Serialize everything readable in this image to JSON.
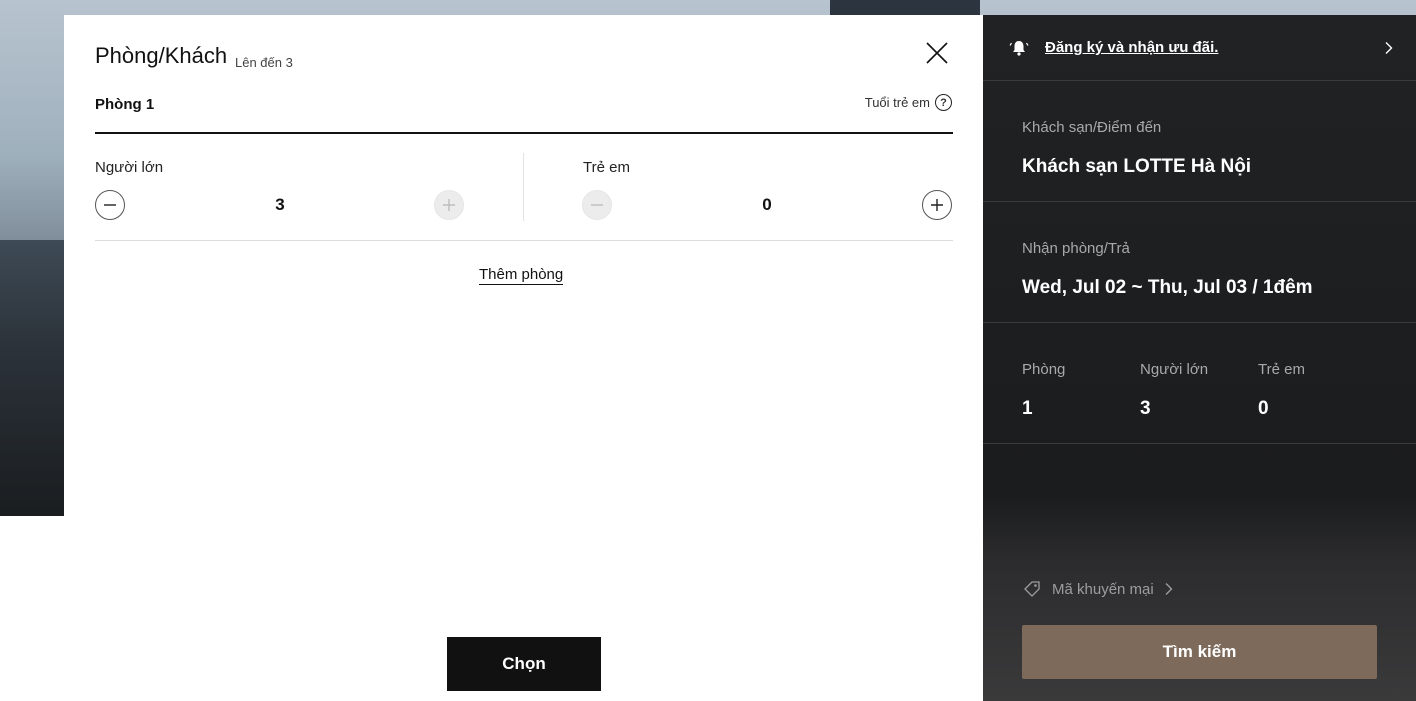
{
  "modal": {
    "title": "Phòng/Khách",
    "subtitle": "Lên đến 3",
    "room_label": "Phòng 1",
    "child_age_label": "Tuổi trẻ em",
    "help_glyph": "?",
    "adults": {
      "label": "Người lớn",
      "value": "3"
    },
    "children": {
      "label": "Trẻ em",
      "value": "0"
    },
    "add_room_label": "Thêm phòng",
    "choose_label": "Chọn"
  },
  "sidebar": {
    "promo_link": "Đăng ký và nhận ưu đãi.",
    "hotel": {
      "label": "Khách sạn/Điểm đến",
      "value": "Khách sạn LOTTE Hà Nội"
    },
    "dates": {
      "label": "Nhận phòng/Trả",
      "value": "Wed, Jul 02 ~ Thu, Jul 03 / 1đêm"
    },
    "counts": [
      {
        "label": "Phòng",
        "value": "1"
      },
      {
        "label": "Người lớn",
        "value": "3"
      },
      {
        "label": "Trẻ em",
        "value": "0"
      }
    ],
    "promo_code_label": "Mã khuyến mại",
    "search_label": "Tìm kiếm"
  },
  "colors": {
    "search_button": "#7d6a5a",
    "panel_bg": "#1f2022",
    "choose_button": "#111111"
  },
  "icons": [
    "bell-icon",
    "chevron-right-icon",
    "close-icon",
    "help-icon",
    "minus-icon",
    "plus-icon",
    "tag-icon"
  ]
}
